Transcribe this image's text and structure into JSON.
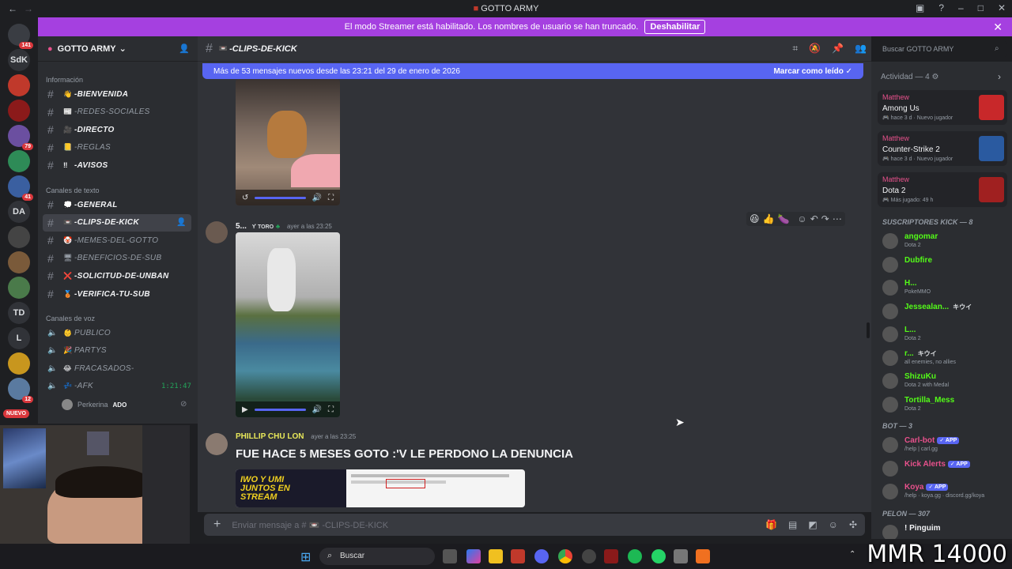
{
  "window": {
    "title": "GOTTO ARMY"
  },
  "banner": {
    "text": "El modo Streamer está habilitado. Los nombres de usuario se han truncado.",
    "button": "Deshabilitar"
  },
  "rail": {
    "servers": [
      {
        "label": "",
        "badge": "141",
        "color": "#3a3d43"
      },
      {
        "label": "SdK",
        "badge": "",
        "color": "#313338"
      },
      {
        "label": "",
        "badge": "",
        "color": "#c0392b"
      },
      {
        "label": "",
        "badge": "",
        "color": "#8b1a1a"
      },
      {
        "label": "",
        "badge": "79",
        "color": "#6b4fa0"
      },
      {
        "label": "",
        "badge": "",
        "color": "#2e8b57"
      },
      {
        "label": "",
        "badge": "41",
        "color": "#3a5fa0"
      },
      {
        "label": "DA",
        "badge": "",
        "color": "#313338"
      },
      {
        "label": "",
        "badge": "",
        "color": "#444"
      },
      {
        "label": "",
        "badge": "",
        "color": "#7a5a3a"
      },
      {
        "label": "",
        "badge": "",
        "color": "#4a7a4a"
      },
      {
        "label": "TD",
        "badge": "",
        "color": "#313338"
      },
      {
        "label": "L",
        "badge": "",
        "color": "#313338"
      },
      {
        "label": "",
        "badge": "",
        "color": "#c8961e"
      },
      {
        "label": "",
        "badge": "12",
        "color": "#5a7aa0"
      }
    ],
    "new_badge": "NUEVO"
  },
  "sidebar": {
    "server_name": "GOTTO ARMY",
    "categories": [
      "Información",
      "Canales de texto",
      "Canales de voz"
    ],
    "info_channels": [
      {
        "emoji": "👋",
        "name": "-BIENVENIDA",
        "muted": false
      },
      {
        "emoji": "📰",
        "name": "-REDES-SOCIALES",
        "muted": true
      },
      {
        "emoji": "🎥",
        "name": "-DIRECTO",
        "muted": false
      },
      {
        "emoji": "📒",
        "name": "-REGLAS",
        "muted": true
      },
      {
        "emoji": "‼",
        "name": "-AVISOS",
        "muted": false
      }
    ],
    "text_channels": [
      {
        "emoji": "💭",
        "name": "-GENERAL",
        "muted": false
      },
      {
        "emoji": "📼",
        "name": "-CLIPS-DE-KICK",
        "muted": false
      },
      {
        "emoji": "🤡",
        "name": "-MEMES-DEL-GOTTO",
        "muted": true
      },
      {
        "emoji": "🖥",
        "name": "-BENEFICIOS-DE-SUB",
        "muted": true
      },
      {
        "emoji": "❌",
        "name": "-SOLICITUD-DE-UNBAN",
        "muted": false
      },
      {
        "emoji": "🥉",
        "name": "-VERIFICA-TU-SUB",
        "muted": false
      }
    ],
    "voice_channels": [
      {
        "emoji": "👶",
        "name": "PUBLICO"
      },
      {
        "emoji": "🎉",
        "name": "PARTYS"
      },
      {
        "emoji": "😂",
        "name": "FRACASADOS-"
      },
      {
        "emoji": "💤",
        "name": "-AFK"
      }
    ],
    "afk_timer": "1:21:47",
    "voice_user": "Perkerina",
    "voice_user_tag": "ADO"
  },
  "chat": {
    "channel": "-CLIPS-DE-KICK",
    "channel_emoji": "📼",
    "new_messages": "Más de 53 mensajes nuevos desde las 23:21 del 29 de enero de 2026",
    "mark_read": "Marcar como leído",
    "messages": [
      {
        "author": "5...",
        "tag": "TORO",
        "time": "ayer a las 23:25",
        "color": "#f2f3f5"
      },
      {
        "author": "PHILLIP CHU LON",
        "time": "ayer a las 23:25",
        "color": "#e8e85a",
        "heading": "FUE HACE 5 MESES GOTO :'V LE PERDONO LA DENUNCIA"
      }
    ],
    "embed_text": "IWO Y UMI JUNTOS EN STREAM",
    "reactions": [
      "😆",
      "👍",
      "🍆"
    ],
    "composer_placeholder": "Enviar mensaje a # 📼 -CLIPS-DE-KICK"
  },
  "members": {
    "search_placeholder": "Buscar GOTTO ARMY",
    "activity_title": "Actividad — 4",
    "activity": [
      {
        "user": "Matthew",
        "game": "Among Us",
        "meta": "hace 3 d  ·  Nuevo jugador",
        "color": "#c8282a"
      },
      {
        "user": "Matthew",
        "game": "Counter-Strike 2",
        "meta": "hace 3 d  ·  Nuevo jugador",
        "color": "#2a5aa0"
      },
      {
        "user": "Matthew",
        "game": "Dota 2",
        "meta": "Más jugado: 49 h",
        "color": "#a02020"
      }
    ],
    "sections": [
      {
        "title": "SUSCRIPTORES KICK — 8",
        "members": [
          {
            "name": "angomar",
            "status": "Dota 2",
            "color": "#53fc18"
          },
          {
            "name": "Dubfire",
            "status": "",
            "color": "#53fc18"
          },
          {
            "name": "H...",
            "status": "PokeMMO",
            "color": "#53fc18"
          },
          {
            "name": "Jessealan...",
            "status": "",
            "color": "#53fc18",
            "tag": "キウイ"
          },
          {
            "name": "L...",
            "status": "Dota 2",
            "color": "#53fc18"
          },
          {
            "name": "r...",
            "status": "all enemies, no allies",
            "color": "#53fc18",
            "tag": "キウイ"
          },
          {
            "name": "ShizuKu",
            "status": "Dota 2 with Medal",
            "color": "#53fc18"
          },
          {
            "name": "Tortilla_Mess",
            "status": "Dota 2",
            "color": "#53fc18"
          }
        ]
      },
      {
        "title": "BOT — 3",
        "members": [
          {
            "name": "Carl-bot",
            "status": "/help | carl.gg",
            "color": "#e8518c",
            "app": "APP"
          },
          {
            "name": "Kick Alerts",
            "status": "",
            "color": "#e8518c",
            "app": "APP"
          },
          {
            "name": "Koya",
            "status": "/help · koya.gg · discord.gg/koya",
            "color": "#e8518c",
            "app": "APP"
          }
        ]
      },
      {
        "title": "PELON — 307",
        "members": [
          {
            "name": "! Pinguim",
            "status": "",
            "color": "#f2f3f5"
          }
        ]
      }
    ]
  },
  "taskbar": {
    "search": "Buscar"
  },
  "overlay": {
    "mmr": "MMR 14000"
  }
}
